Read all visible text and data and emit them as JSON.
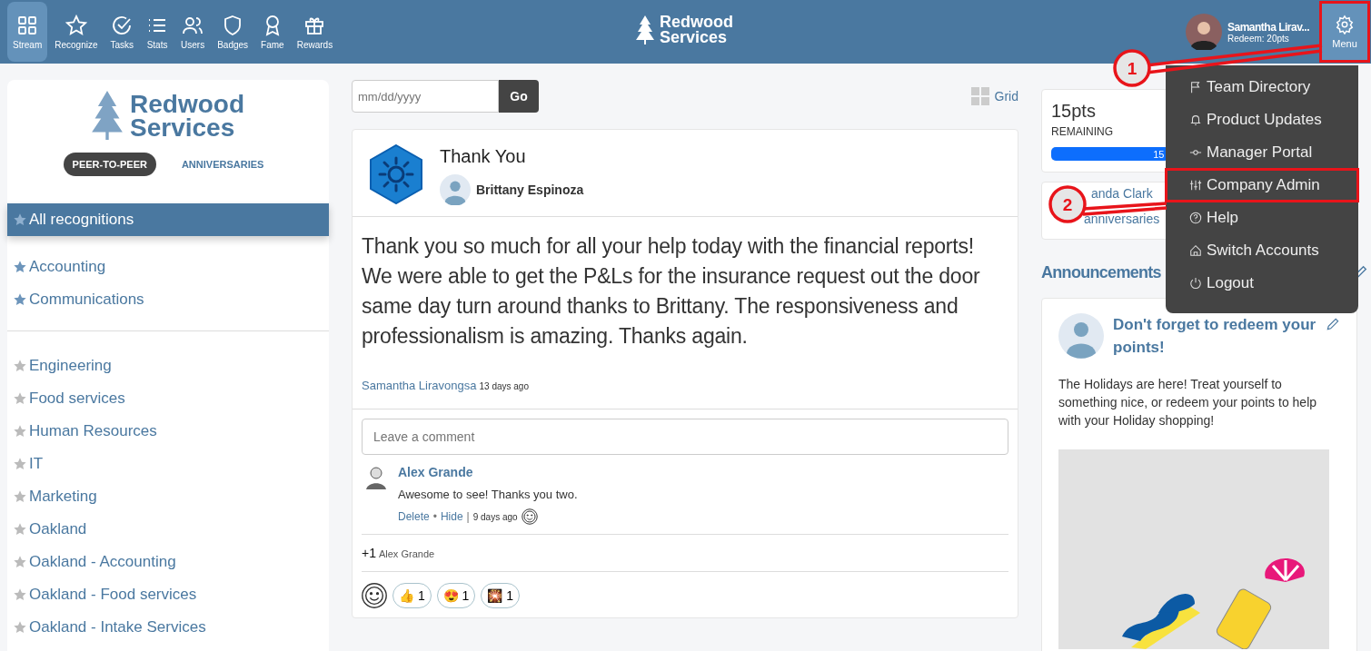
{
  "nav": [
    {
      "label": "Stream",
      "selected": true
    },
    {
      "label": "Recognize",
      "selected": false
    },
    {
      "label": "Tasks",
      "selected": false
    },
    {
      "label": "Stats",
      "selected": false
    },
    {
      "label": "Users",
      "selected": false
    },
    {
      "label": "Badges",
      "selected": false
    },
    {
      "label": "Fame",
      "selected": false
    },
    {
      "label": "Rewards",
      "selected": false
    }
  ],
  "brand": {
    "line1": "Redwood",
    "line2": "Services"
  },
  "user": {
    "name": "Samantha Lirav...",
    "redeem": "Redeem: 20pts"
  },
  "menu_button": {
    "label": "Menu",
    "highlighted": true
  },
  "menu": [
    {
      "label": "Team Directory",
      "highlighted": false
    },
    {
      "label": "Product Updates",
      "highlighted": false
    },
    {
      "label": "Manager Portal",
      "highlighted": false
    },
    {
      "label": "Company Admin",
      "highlighted": true
    },
    {
      "label": "Help",
      "highlighted": false
    },
    {
      "label": "Switch Accounts",
      "highlighted": false
    },
    {
      "label": "Logout",
      "highlighted": false
    }
  ],
  "callouts": [
    "1",
    "2"
  ],
  "sidebar": {
    "logo": {
      "line1": "Redwood",
      "line2": "Services"
    },
    "tabs": [
      {
        "label": "PEER-TO-PEER",
        "selected": true
      },
      {
        "label": "ANNIVERSARIES",
        "selected": false
      }
    ],
    "groups": [
      [
        {
          "label": "All recognitions",
          "selected": true,
          "favorite": true
        }
      ],
      [
        {
          "label": "Accounting",
          "selected": false,
          "favorite": true
        },
        {
          "label": "Communications",
          "selected": false,
          "favorite": true
        }
      ],
      [
        {
          "label": "Engineering",
          "selected": false,
          "favorite": false
        },
        {
          "label": "Food services",
          "selected": false,
          "favorite": false
        },
        {
          "label": "Human Resources",
          "selected": false,
          "favorite": false
        },
        {
          "label": "IT",
          "selected": false,
          "favorite": false
        },
        {
          "label": "Marketing",
          "selected": false,
          "favorite": false
        },
        {
          "label": "Oakland",
          "selected": false,
          "favorite": false
        },
        {
          "label": "Oakland - Accounting",
          "selected": false,
          "favorite": false
        },
        {
          "label": "Oakland - Food services",
          "selected": false,
          "favorite": false
        },
        {
          "label": "Oakland - Intake Services",
          "selected": false,
          "favorite": false
        }
      ]
    ]
  },
  "date_filter": {
    "placeholder": "mm/dd/yyyy",
    "button": "Go"
  },
  "view_toggle": "Grid",
  "post": {
    "title": "Thank You",
    "recipient": "Brittany Espinoza",
    "message": "Thank you so much for all your help today with the financial reports! We were able to get the P&Ls for the insurance request out the door same day turn around thanks to Brittany. The responsiveness and professionalism is amazing. Thanks again.",
    "author": "Samantha Liravongsa",
    "time": "13 days ago",
    "comment_placeholder": "Leave a comment",
    "comments": [
      {
        "author": "Alex Grande",
        "text": "Awesome to see! Thanks you two.",
        "actions": [
          "Delete",
          "Hide"
        ],
        "action_separator": "•",
        "time_separator": "|",
        "time": "9 days ago"
      }
    ],
    "plus_one": {
      "count": "+1",
      "name": "Alex Grande"
    },
    "reactions": [
      {
        "emoji": "👍",
        "count": "1"
      },
      {
        "emoji": "😍",
        "count": "1"
      },
      {
        "emoji": "🎇",
        "count": "1"
      }
    ]
  },
  "points": {
    "value": "15pts",
    "caption": "REMAINING",
    "bar_label": "15",
    "level": 0.4
  },
  "person_card": {
    "name": "anda Clark",
    "link": "anniversaries"
  },
  "announcements": {
    "title": "Announcements",
    "items": [
      {
        "title": "Don't forget to redeem your points!",
        "body": "The Holidays are here! Treat yourself to something nice, or redeem your points to help with your Holiday shopping!",
        "kind": "picture"
      }
    ]
  }
}
